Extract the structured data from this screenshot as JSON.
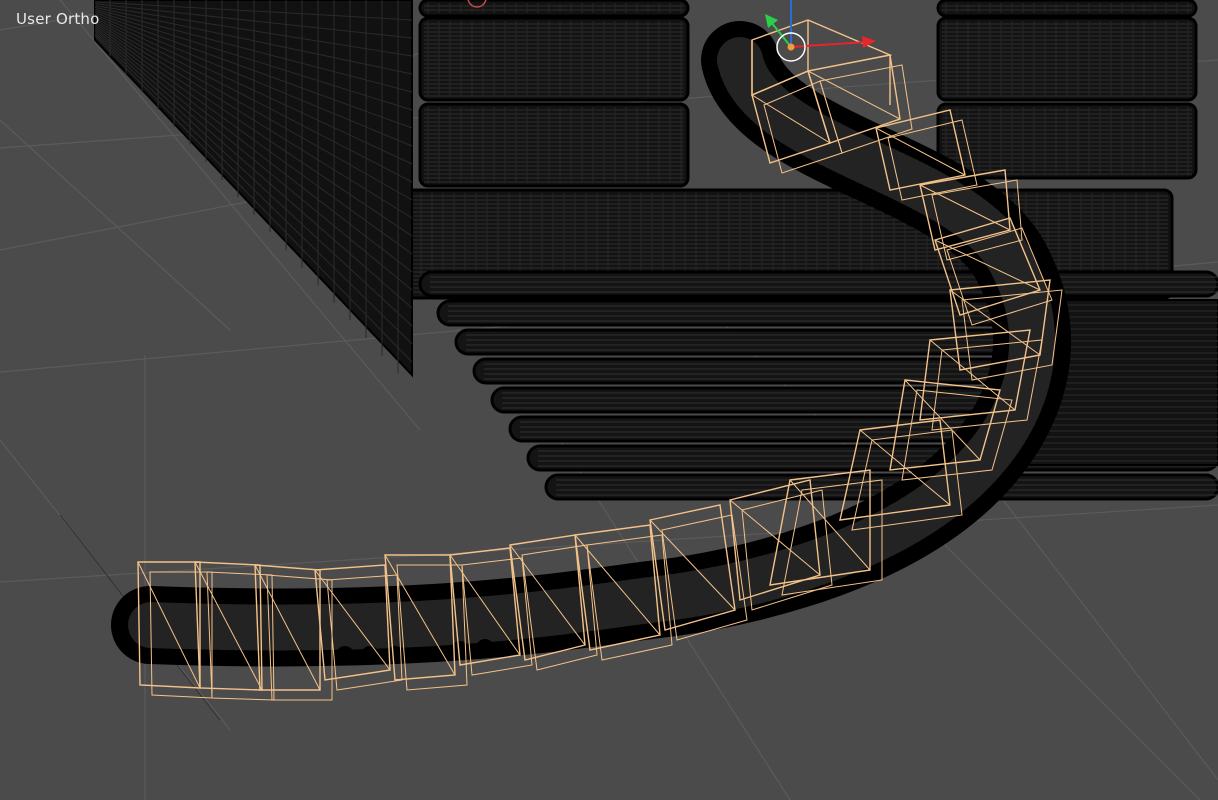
{
  "viewport": {
    "view_label": "User Ortho",
    "background": "#4b4b4b",
    "grid_color": "#5b5b5b",
    "wire_color": "#000000",
    "selection_color": "#f3c28a",
    "gizmo": {
      "x_color": "#e8242c",
      "y_color": "#2ad04a",
      "z_color": "#2a6dd4",
      "origin_color": "#f59a3a"
    }
  }
}
